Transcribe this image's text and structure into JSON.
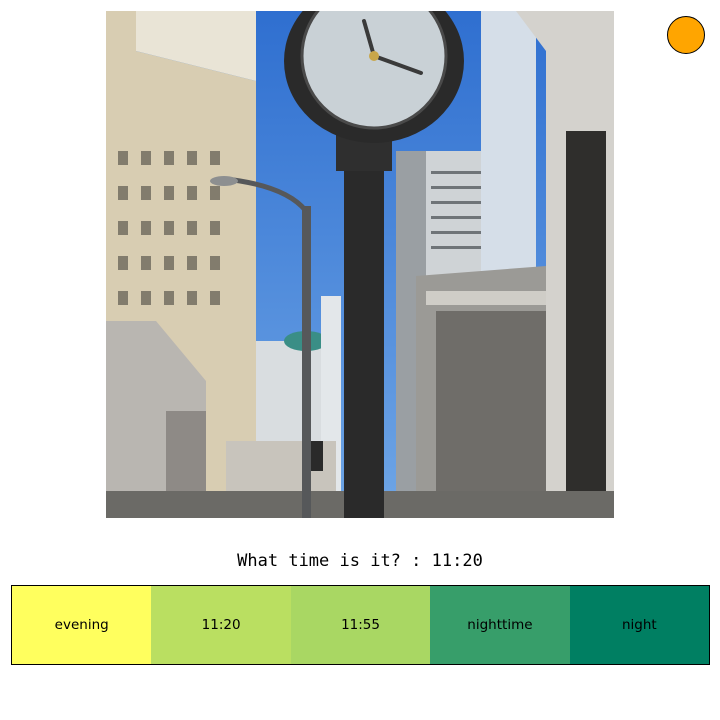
{
  "question": {
    "prompt": "What time is it?",
    "separator": " : ",
    "current_answer": "11:20"
  },
  "answers": [
    {
      "label": "evening",
      "color": "#ffff5e"
    },
    {
      "label": "11:20",
      "color": "#badf61"
    },
    {
      "label": "11:55",
      "color": "#a9d763"
    },
    {
      "label": "nighttime",
      "color": "#379e6a"
    },
    {
      "label": "night",
      "color": "#007f62"
    }
  ],
  "status_indicator": {
    "color": "#ffa500"
  },
  "photo": {
    "subject": "street clock among city buildings"
  }
}
